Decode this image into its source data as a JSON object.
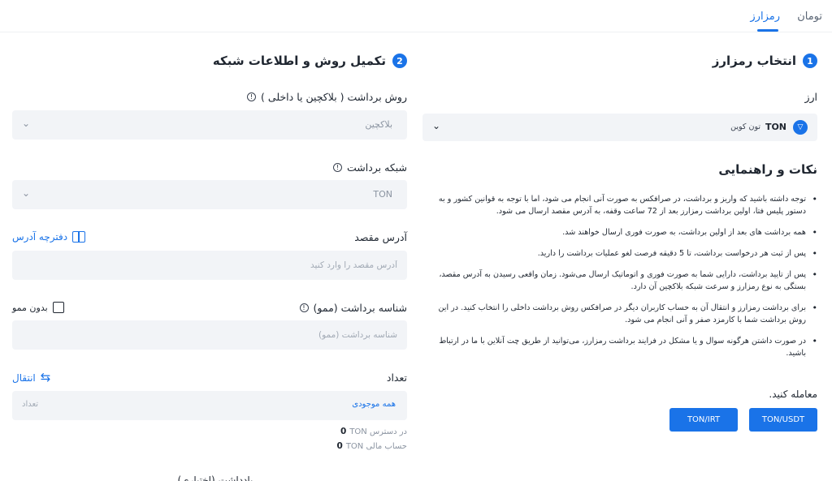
{
  "tabs": [
    {
      "label": "تومان"
    },
    {
      "label": "رمزارز"
    }
  ],
  "step1": {
    "number": "1",
    "title": "انتخاب رمزارز",
    "currency_label": "ارز",
    "coin": {
      "symbol": "TON",
      "name": "تون کوین",
      "icon": "ton-icon"
    }
  },
  "tips": {
    "title": "نکات و راهنمایی",
    "items": [
      "توجه داشته باشید که واریز و برداشت، در صرافکس به صورت آنی انجام می شود، اما با توجه به قوانین کشور و به دستور پلیس فتا، اولین برداشت رمزارز بعد از 72 ساعت وقفه، به آدرس مقصد ارسال می شود.",
      "همه برداشت های بعد از اولین برداشت، به صورت فوری ارسال خواهند شد.",
      "پس از ثبت هر درخواست برداشت، تا 5 دقیقه فرصت لغو عملیات برداشت را دارید.",
      "پس از تایید برداشت، دارایی شما به صورت فوری و اتوماتیک ارسال می‌شود. زمان واقعی رسیدن به آدرس مقصد، بستگی به نوع رمزارز و سرعت شبکه بلاکچین آن دارد.",
      "برای برداشت رمزارز و انتقال آن به حساب کاربران دیگر در صرافکس روش برداشت داخلی را انتخاب کنید. در این روش برداشت شما با کارمزد صفر و آنی انجام می شود.",
      "در صورت داشتن هرگونه سوال و یا مشکل در فرایند برداشت رمزارز، می‌توانید از طریق چت آنلاین با ما در ارتباط باشید."
    ],
    "trade_label": "معامله کنید.",
    "trade_buttons": [
      "TON/USDT",
      "TON/IRT"
    ]
  },
  "step2": {
    "number": "2",
    "title": "تکمیل روش و اطلاعات شبکه",
    "method_label": "روش برداشت ( بلاکچین یا داخلی )",
    "method_value": "بلاکچین",
    "network_label": "شبکه برداشت",
    "network_value": "TON",
    "address_label": "آدرس مقصد",
    "address_book": "دفترچه آدرس",
    "address_placeholder": "آدرس مقصد را وارد کنید",
    "memo_label": "شناسه برداشت (ممو)",
    "no_memo": "بدون ممو",
    "memo_placeholder": "شناسه برداشت (ممو)",
    "amount_label": "تعداد",
    "transfer": "انتقال",
    "all_balance": "همه موجودی",
    "amount_placeholder": "تعداد",
    "available_label": "در دسترس TON",
    "available_value": "0",
    "financial_label": "حساب مالی TON",
    "financial_value": "0",
    "note_label": "یادداشت (اختیاری)"
  }
}
